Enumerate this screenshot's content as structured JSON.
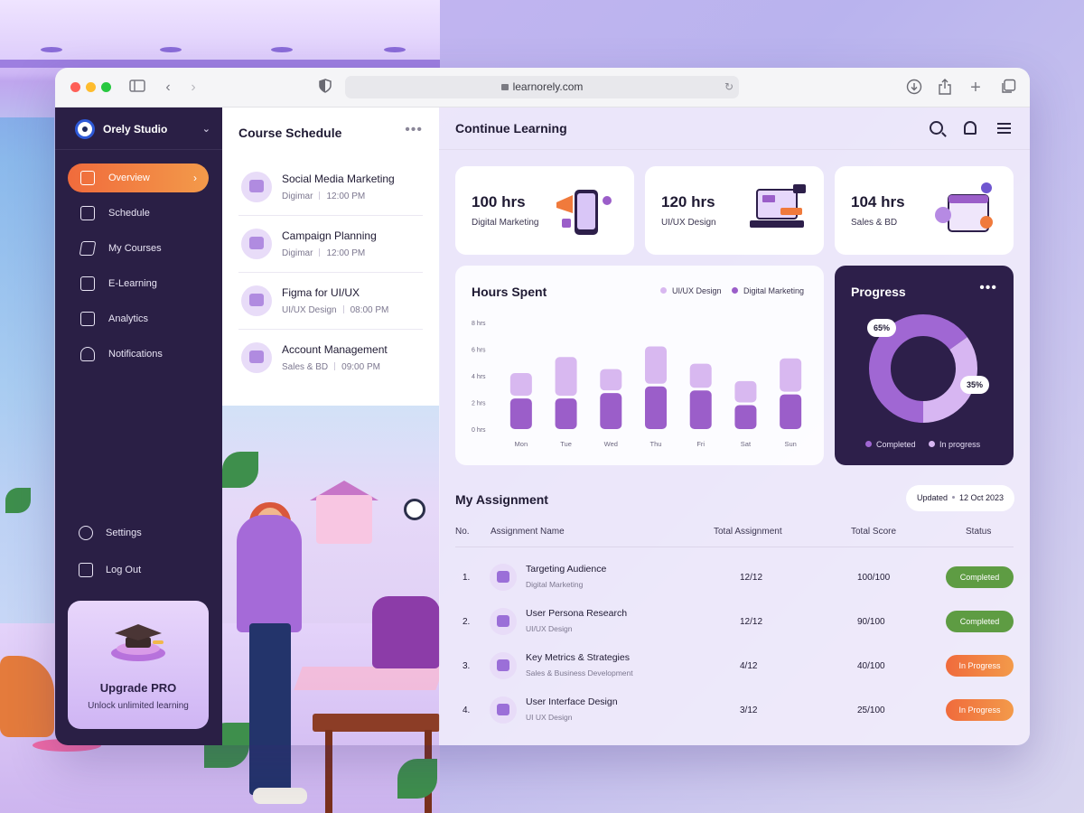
{
  "browser": {
    "url": "learnorely.com"
  },
  "sidebar": {
    "brand": "Orely Studio",
    "items": [
      {
        "label": "Overview",
        "icon": "overview-icon",
        "active": true
      },
      {
        "label": "Schedule",
        "icon": "calendar-icon"
      },
      {
        "label": "My Courses",
        "icon": "graduation-cap-icon"
      },
      {
        "label": "E-Learning",
        "icon": "video-icon"
      },
      {
        "label": "Analytics",
        "icon": "analytics-icon"
      },
      {
        "label": "Notifications",
        "icon": "bell-icon"
      }
    ],
    "settings": "Settings",
    "logout": "Log Out",
    "upgrade": {
      "title": "Upgrade PRO",
      "subtitle": "Unlock unlimited learning"
    }
  },
  "schedule": {
    "title": "Course Schedule",
    "courses": [
      {
        "name": "Social Media Marketing",
        "category": "Digimar",
        "time": "12:00 PM"
      },
      {
        "name": "Campaign Planning",
        "category": "Digimar",
        "time": "12:00 PM"
      },
      {
        "name": "Figma for UI/UX",
        "category": "UI/UX Design",
        "time": "08:00 PM"
      },
      {
        "name": "Account Management",
        "category": "Sales & BD",
        "time": "09:00 PM"
      }
    ]
  },
  "main": {
    "title": "Continue Learning",
    "stats": [
      {
        "value": "100 hrs",
        "label": "Digital Marketing"
      },
      {
        "value": "120 hrs",
        "label": "UI/UX Design"
      },
      {
        "value": "104 hrs",
        "label": "Sales & BD"
      }
    ]
  },
  "hours": {
    "title": "Hours Spent",
    "legend": [
      "UI/UX Design",
      "Digital Marketing"
    ]
  },
  "chart_data": {
    "type": "bar",
    "title": "Hours Spent",
    "categories": [
      "Mon",
      "Tue",
      "Wed",
      "Thu",
      "Fri",
      "Sat",
      "Sun"
    ],
    "yticks": [
      "0 hrs",
      "2 hrs",
      "4 hrs",
      "6 hrs",
      "8 hrs"
    ],
    "ylim": [
      0,
      8
    ],
    "stacked": true,
    "series": [
      {
        "name": "Digital Marketing",
        "values": [
          2.3,
          2.3,
          2.7,
          3.2,
          2.9,
          1.8,
          2.6
        ],
        "color": "#9b5ec9"
      },
      {
        "name": "UI/UX Design",
        "values": [
          1.7,
          2.9,
          1.6,
          2.8,
          1.8,
          1.6,
          2.5
        ],
        "color": "#d8b8f0"
      }
    ]
  },
  "progress": {
    "title": "Progress",
    "completed_pct": "65%",
    "inprogress_pct": "35%",
    "legend": [
      "Completed",
      "In progress"
    ],
    "completed_value": 65,
    "inprogress_value": 35,
    "colors": {
      "completed": "#a067d3",
      "inprogress": "#d7b6f2"
    }
  },
  "assignment": {
    "title": "My Assignment",
    "updated_label": "Updated",
    "updated_date": "12 Oct 2023",
    "headers": [
      "No.",
      "Assignment Name",
      "Total Assignment",
      "Total Score",
      "Status"
    ],
    "rows": [
      {
        "no": "1.",
        "name": "Targeting Audience",
        "sub": "Digital Marketing",
        "total": "12/12",
        "score": "100/100",
        "status": "Completed"
      },
      {
        "no": "2.",
        "name": "User Persona Research",
        "sub": "UI/UX Design",
        "total": "12/12",
        "score": "90/100",
        "status": "Completed"
      },
      {
        "no": "3.",
        "name": "Key Metrics & Strategies",
        "sub": "Sales & Business Development",
        "total": "4/12",
        "score": "40/100",
        "status": "In Progress"
      },
      {
        "no": "4.",
        "name": "User Interface Design",
        "sub": "UI UX Design",
        "total": "3/12",
        "score": "25/100",
        "status": "In Progress"
      }
    ]
  }
}
